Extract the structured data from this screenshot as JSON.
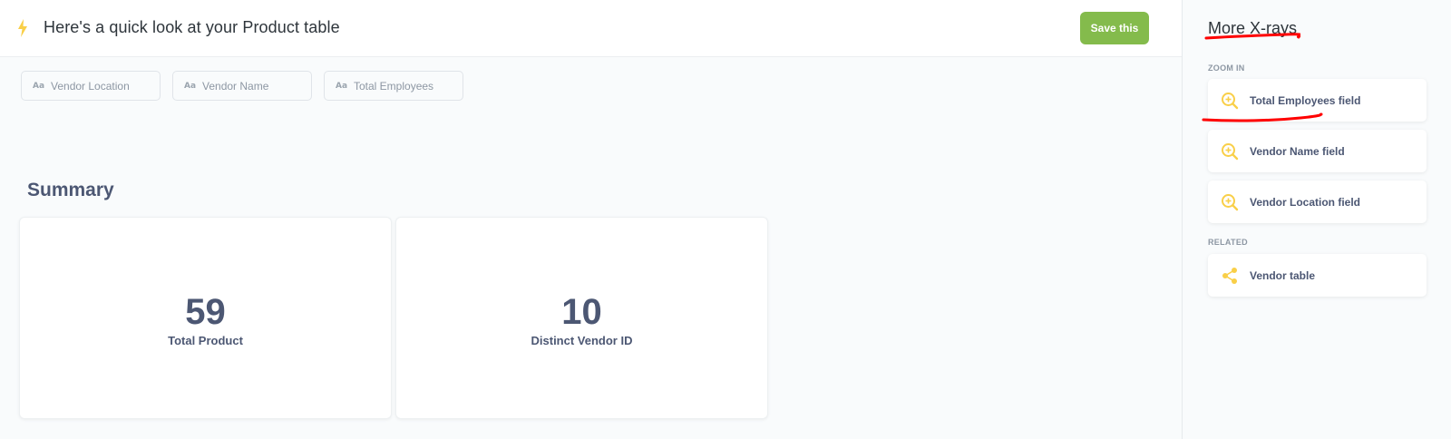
{
  "header": {
    "title": "Here's a quick look at your Product table",
    "save_label": "Save this"
  },
  "chips": [
    {
      "type_icon": "Aa",
      "label": "Vendor Location"
    },
    {
      "type_icon": "Aa",
      "label": "Vendor Name"
    },
    {
      "type_icon": "Aa",
      "label": "Total Employees"
    }
  ],
  "summary": {
    "title": "Summary",
    "cards": [
      {
        "value": "59",
        "label": "Total Product"
      },
      {
        "value": "10",
        "label": "Distinct Vendor ID"
      }
    ]
  },
  "sidebar": {
    "title": "More X-rays",
    "zoom_in_label": "ZOOM IN",
    "zoom_in_items": [
      {
        "label": "Total Employees field",
        "icon": "zoom-in-icon"
      },
      {
        "label": "Vendor Name field",
        "icon": "zoom-in-icon"
      },
      {
        "label": "Vendor Location field",
        "icon": "zoom-in-icon"
      }
    ],
    "related_label": "RELATED",
    "related_items": [
      {
        "label": "Vendor table",
        "icon": "share-icon"
      }
    ]
  },
  "colors": {
    "accent_yellow": "#f9cf48",
    "save_green": "#84bb4c",
    "annotation_red": "#ff0000",
    "text": "#4c5773"
  }
}
